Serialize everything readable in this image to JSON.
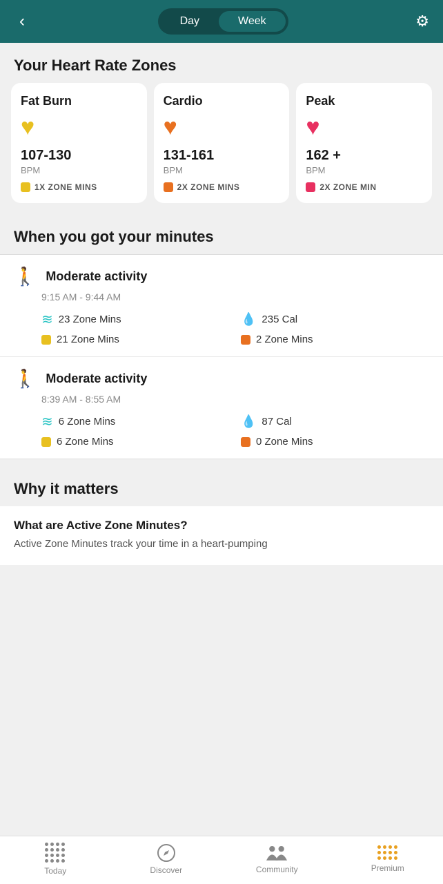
{
  "header": {
    "back_label": "‹",
    "toggle": {
      "day_label": "Day",
      "week_label": "Week",
      "active": "week"
    },
    "settings_label": "⚙"
  },
  "heart_rate_zones": {
    "section_title": "Your Heart Rate Zones",
    "cards": [
      {
        "name": "Fat Burn",
        "heart_color": "#e8c020",
        "bpm_range": "107-130",
        "bpm_label": "BPM",
        "dot_color": "#e8c020",
        "zone_mins_label": "1X ZONE MINS"
      },
      {
        "name": "Cardio",
        "heart_color": "#e87020",
        "bpm_range": "131-161",
        "bpm_label": "BPM",
        "dot_color": "#e87020",
        "zone_mins_label": "2X ZONE MINS"
      },
      {
        "name": "Peak",
        "heart_color": "#e83060",
        "bpm_range": "162 +",
        "bpm_label": "BPM",
        "dot_color": "#e83060",
        "zone_mins_label": "2X ZONE MIN"
      }
    ]
  },
  "when_you_got_minutes": {
    "section_title": "When you got your minutes",
    "activities": [
      {
        "title": "Moderate activity",
        "time": "9:15 AM - 9:44 AM",
        "stats": [
          {
            "icon": "wave",
            "value": "23 Zone Mins"
          },
          {
            "icon": "drop",
            "value": "235 Cal"
          },
          {
            "icon": "yellow",
            "value": "21 Zone Mins"
          },
          {
            "icon": "orange",
            "value": "2 Zone Mins"
          }
        ]
      },
      {
        "title": "Moderate activity",
        "time": "8:39 AM - 8:55 AM",
        "stats": [
          {
            "icon": "wave",
            "value": "6 Zone Mins"
          },
          {
            "icon": "drop",
            "value": "87 Cal"
          },
          {
            "icon": "yellow",
            "value": "6 Zone Mins"
          },
          {
            "icon": "orange",
            "value": "0 Zone Mins"
          }
        ]
      }
    ]
  },
  "why_it_matters": {
    "section_title": "Why it matters",
    "faq_title": "What are Active Zone Minutes?",
    "faq_text": "Active Zone Minutes track your time in a heart-pumping"
  },
  "bottom_nav": {
    "items": [
      {
        "id": "today",
        "label": "Today"
      },
      {
        "id": "discover",
        "label": "Discover"
      },
      {
        "id": "community",
        "label": "Community"
      },
      {
        "id": "premium",
        "label": "Premium"
      }
    ]
  }
}
